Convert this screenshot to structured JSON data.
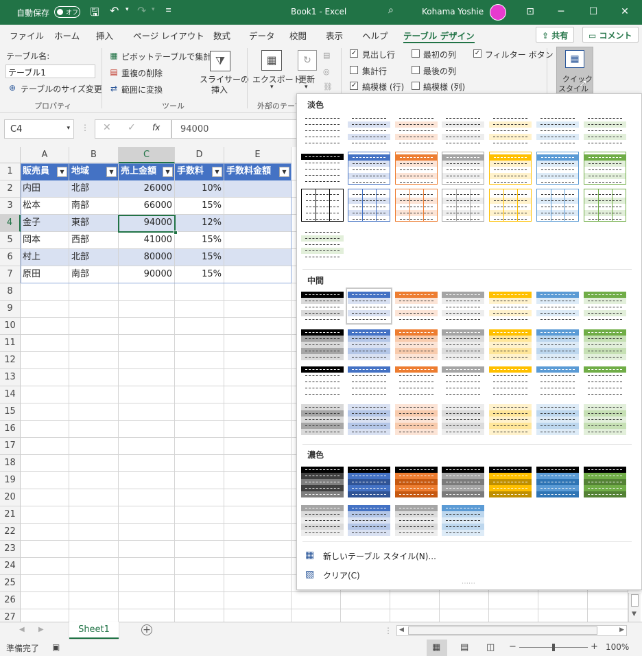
{
  "titlebar": {
    "autosave_label": "自動保存",
    "autosave_state": "オフ",
    "doc_title": "Book1 - Excel",
    "user_name": "Kohama Yoshie"
  },
  "tabs": {
    "file": "ファイル",
    "home": "ホーム",
    "insert": "挿入",
    "page_layout": "ページ レイアウト",
    "formulas": "数式",
    "data": "データ",
    "review": "校閲",
    "view": "表示",
    "help": "ヘルプ",
    "table_design": "テーブル デザイン",
    "share": "共有",
    "comments": "コメント"
  },
  "ribbon": {
    "table_name_label": "テーブル名:",
    "table_name_value": "テーブル1",
    "resize_table": "テーブルのサイズ変更",
    "group_properties": "プロパティ",
    "pivot": "ピボットテーブルで集計",
    "remove_dup": "重複の削除",
    "convert_range": "範囲に変換",
    "slicer_1": "スライサーの",
    "slicer_2": "挿入",
    "group_tools": "ツール",
    "export": "エクスポート",
    "refresh": "更新",
    "group_external": "外部のテーブ",
    "opt_header_row": "見出し行",
    "opt_total_row": "集計行",
    "opt_banded_rows": "縞模様 (行)",
    "opt_first_col": "最初の列",
    "opt_last_col": "最後の列",
    "opt_banded_cols": "縞模様 (列)",
    "opt_filter_button": "フィルター ボタン",
    "quick_styles_1": "クイック",
    "quick_styles_2": "スタイル"
  },
  "formula_bar": {
    "namebox": "C4",
    "fx": "fx",
    "value": "94000"
  },
  "columns": [
    "A",
    "B",
    "C",
    "D",
    "E"
  ],
  "rows": [
    "1",
    "2",
    "3",
    "4",
    "5",
    "6",
    "7",
    "8",
    "9",
    "10",
    "11",
    "12",
    "13",
    "14",
    "15",
    "16",
    "17",
    "18",
    "19",
    "20",
    "21",
    "22",
    "23",
    "24",
    "25",
    "26",
    "27"
  ],
  "table": {
    "headers": [
      "販売員",
      "地域",
      "売上金額",
      "手数料",
      "手数料金額"
    ],
    "body": [
      [
        "内田",
        "北部",
        "26000",
        "10%",
        ""
      ],
      [
        "松本",
        "南部",
        "66000",
        "15%",
        ""
      ],
      [
        "金子",
        "東部",
        "94000",
        "12%",
        ""
      ],
      [
        "岡本",
        "西部",
        "41000",
        "15%",
        ""
      ],
      [
        "村上",
        "北部",
        "80000",
        "15%",
        ""
      ],
      [
        "原田",
        "南部",
        "90000",
        "15%",
        ""
      ]
    ]
  },
  "gallery": {
    "light": "淡色",
    "medium": "中間",
    "dark": "濃色",
    "new_style": "新しいテーブル スタイル(N)...",
    "clear": "クリア(C)"
  },
  "sheet_tab": "Sheet1",
  "status": {
    "ready": "準備完了",
    "zoom": "100%"
  },
  "colors": {
    "excel_green": "#217346",
    "blue": "#4472c4",
    "orange": "#ed7d31",
    "gray": "#a5a5a5",
    "gold": "#ffc000",
    "lightblue": "#5b9bd5",
    "green": "#70ad47"
  }
}
